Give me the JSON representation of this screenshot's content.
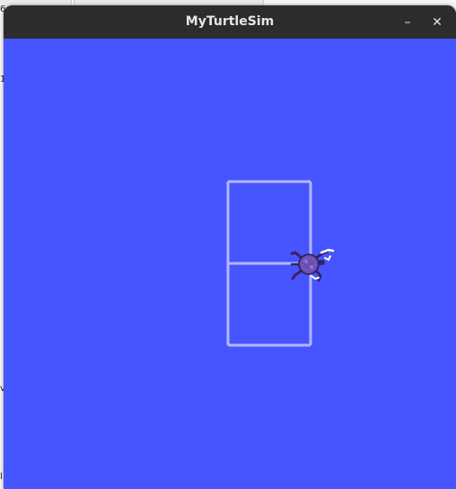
{
  "window": {
    "title": "MyTurtleSim",
    "minimize_glyph": "–",
    "close_glyph": "✕"
  },
  "canvas": {
    "background_color": "#4655ff",
    "pen_color": "#b3b8ff"
  },
  "turtle": {
    "icon": "turtle-icon",
    "shell_color": "#6a4fb0"
  },
  "background_fragments": {
    "top_left": "6",
    "row_1": "1",
    "mid_left": "v",
    "bottom_left": "l"
  }
}
